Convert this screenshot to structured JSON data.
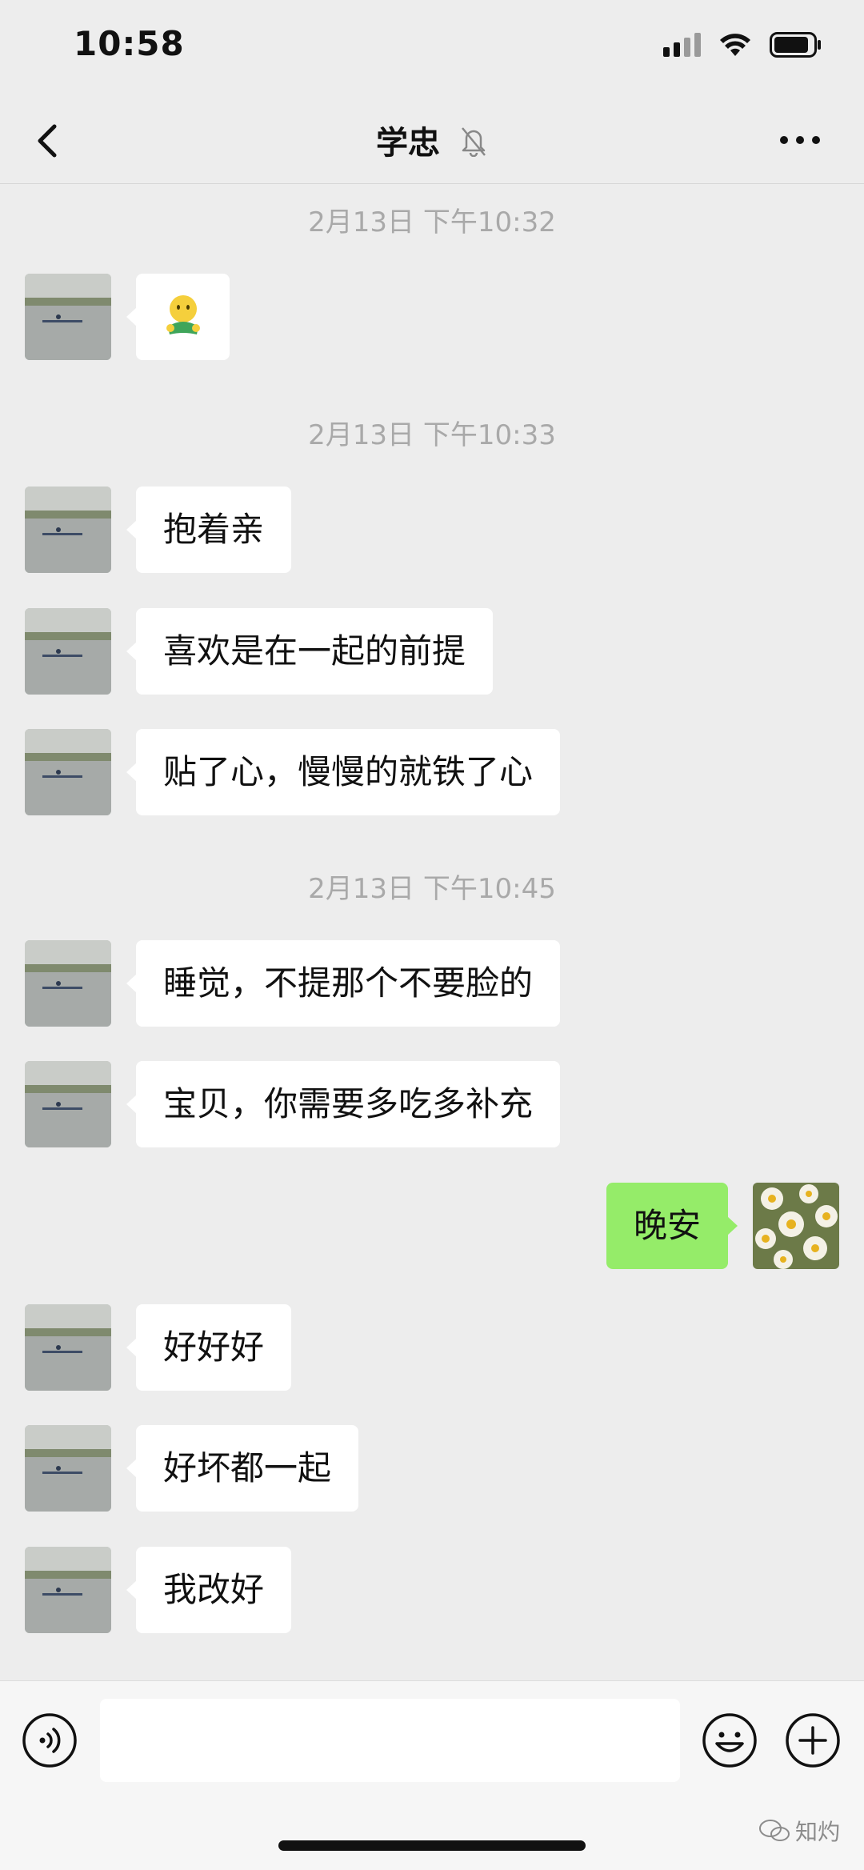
{
  "status_bar": {
    "time": "10:58"
  },
  "header": {
    "title": "学忠"
  },
  "messages": [
    {
      "type": "timestamp",
      "text": "2月13日 下午10:32"
    },
    {
      "type": "emoji",
      "icon": "hug-emoji"
    },
    {
      "type": "timestamp",
      "text": "2月13日 下午10:33"
    },
    {
      "type": "text",
      "side": "left",
      "text": "抱着亲"
    },
    {
      "type": "text",
      "side": "left",
      "text": "喜欢是在一起的前提"
    },
    {
      "type": "text",
      "side": "left",
      "text": "贴了心，慢慢的就铁了心"
    },
    {
      "type": "timestamp",
      "text": "2月13日 下午10:45"
    },
    {
      "type": "text",
      "side": "left",
      "text": "睡觉，不提那个不要脸的"
    },
    {
      "type": "text",
      "side": "left",
      "text": "宝贝，你需要多吃多补充"
    },
    {
      "type": "text",
      "side": "right",
      "text": "晚安"
    },
    {
      "type": "text",
      "side": "left",
      "text": "好好好"
    },
    {
      "type": "text",
      "side": "left",
      "text": "好坏都一起"
    },
    {
      "type": "text",
      "side": "left",
      "text": "我改好"
    }
  ],
  "input_bar": {
    "value": ""
  },
  "watermark": {
    "text": "知灼"
  },
  "colors": {
    "background": "#ededed",
    "bubble_self": "#95ec69",
    "bubble_other": "#ffffff"
  }
}
